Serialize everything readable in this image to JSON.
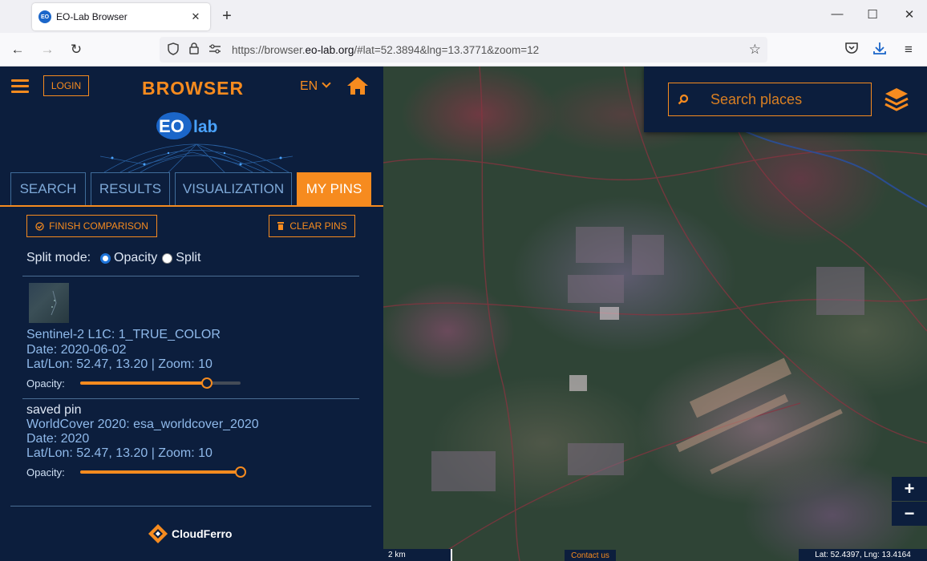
{
  "browser": {
    "tab_title": "EO-Lab Browser",
    "favicon_text": "EO",
    "url_prefix": "https://browser.",
    "url_domain": "eo-lab.org",
    "url_suffix": "/#lat=52.3894&lng=13.3771&zoom=12"
  },
  "header": {
    "login_label": "LOGIN",
    "brand": "BROWSER",
    "language": "EN",
    "logo_text_eo": "EO",
    "logo_text_lab": "lab"
  },
  "tabs": [
    {
      "label": "SEARCH",
      "active": false
    },
    {
      "label": "RESULTS",
      "active": false
    },
    {
      "label": "VISUALIZATION",
      "active": false
    },
    {
      "label": "MY PINS",
      "active": true
    }
  ],
  "pins_panel": {
    "finish_label": "FINISH COMPARISON",
    "clear_label": "CLEAR PINS",
    "split_mode_label": "Split mode:",
    "split_options": [
      {
        "label": "Opacity",
        "selected": true
      },
      {
        "label": "Split",
        "selected": false
      }
    ],
    "pins": [
      {
        "title": "Sentinel-2 L1C: 1_TRUE_COLOR",
        "date": "Date: 2020-06-02",
        "location": "Lat/Lon: 52.47, 13.20 | Zoom: 10",
        "opacity_label": "Opacity:",
        "opacity": 0.79
      },
      {
        "name": " saved pin",
        "title": "WorldCover 2020: esa_worldcover_2020",
        "date": "Date: 2020",
        "location": "Lat/Lon: 52.47, 13.20 | Zoom: 10",
        "opacity_label": "Opacity:",
        "opacity": 1.0
      }
    ]
  },
  "footer": {
    "brand": "CloudFerro"
  },
  "map": {
    "search_placeholder": "Search places",
    "zoom_in": "+",
    "zoom_out": "−",
    "scale_label": "2 km",
    "contact_label": "Contact us",
    "coords_label": "Lat: 52.4397, Lng: 13.4164"
  },
  "colors": {
    "accent": "#f68b1f",
    "panel": "#0c1e3d",
    "link": "#8fb9ea"
  }
}
